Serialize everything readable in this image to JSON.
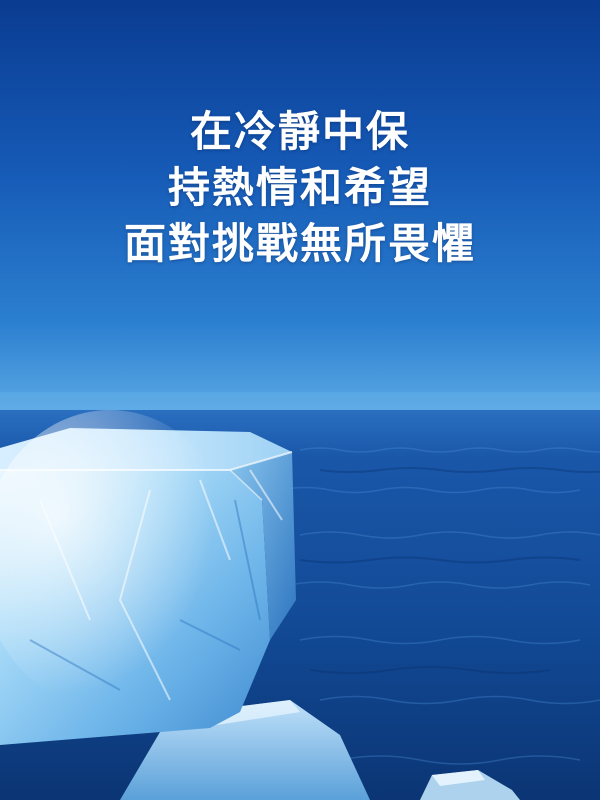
{
  "quote": {
    "lines": [
      "在冷靜中保",
      "持熱情和希望",
      "面對挑戰無所畏懼"
    ]
  },
  "scene": {
    "description_icons": [
      "ice-block-icon",
      "ocean-icon",
      "sky-icon"
    ],
    "colors": {
      "sky_top": "#0a3c91",
      "sky_mid": "#1c68c2",
      "horizon": "#57a7e3",
      "ocean_top": "#1a59ac",
      "ocean_bottom": "#0b3574",
      "ice_light": "#dff1ff",
      "ice_mid": "#86c6f0",
      "ice_dark": "#3f8dd0",
      "text": "#ffffff"
    }
  }
}
